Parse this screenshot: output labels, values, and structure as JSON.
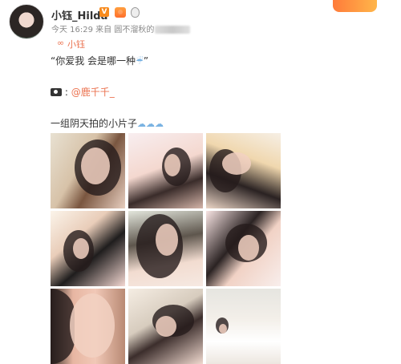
{
  "post": {
    "username": "小钰_Hilda",
    "verified_badge": "V",
    "meta_time": "今天 16:29 来自 圆不溜秋的",
    "tag_label": "小钰",
    "caption_line1": "“你爱我 会是哪一种",
    "caption_line1_end": "”",
    "credit_mention": "@鹿千千_",
    "caption_line3": "一组阴天拍的小片子",
    "cloud_emoji": "☁☁☁",
    "rain_emoji": "☔"
  },
  "colors": {
    "accent_orange": "#eb7350",
    "badge_orange": "#f78a1d"
  },
  "icons": [
    "avatar",
    "verified-badge-icon",
    "level-icon",
    "medal-icon",
    "tag-icon",
    "camera-icon",
    "cloud-icon"
  ],
  "photos": [
    {
      "name": "photo-1"
    },
    {
      "name": "photo-2"
    },
    {
      "name": "photo-3"
    },
    {
      "name": "photo-4"
    },
    {
      "name": "photo-5"
    },
    {
      "name": "photo-6"
    },
    {
      "name": "photo-7"
    },
    {
      "name": "photo-8"
    },
    {
      "name": "photo-9"
    }
  ]
}
